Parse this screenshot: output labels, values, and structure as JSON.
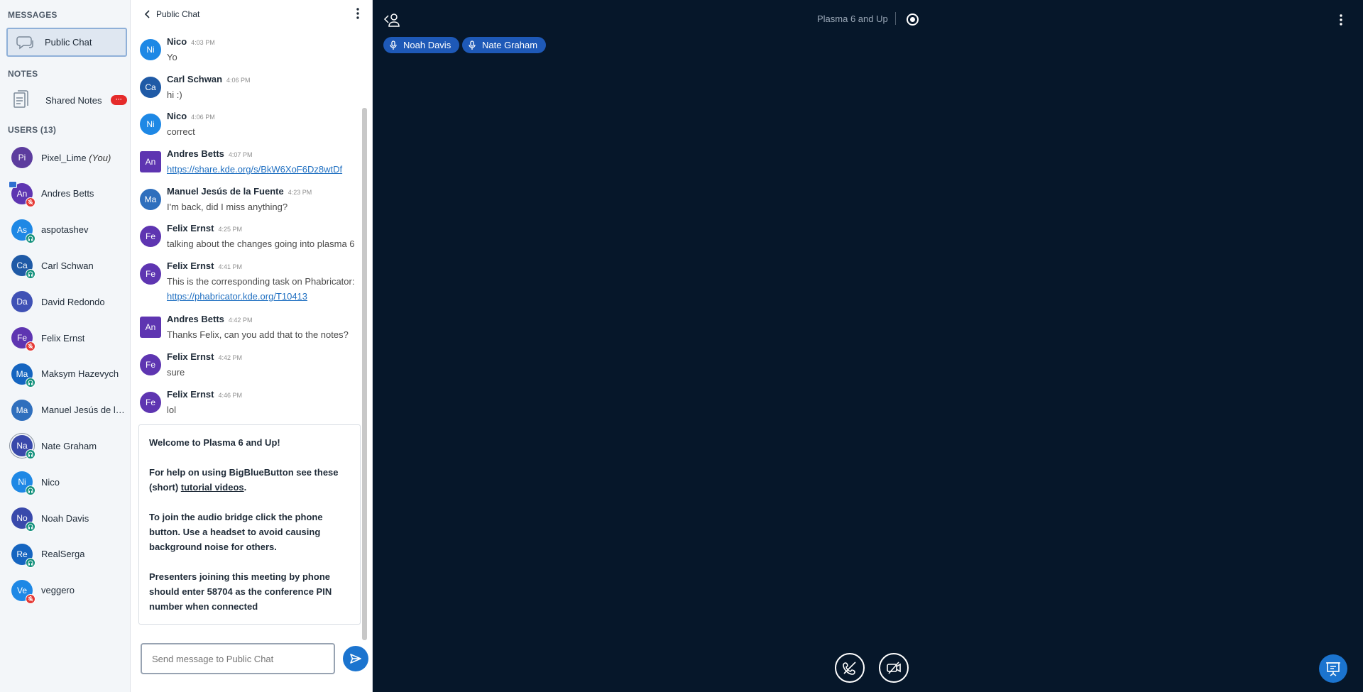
{
  "sidebar": {
    "messages_title": "MESSAGES",
    "public_chat_label": "Public Chat",
    "notes_title": "NOTES",
    "shared_notes_label": "Shared Notes",
    "shared_notes_badge": "···",
    "users_title": "USERS (13)",
    "users": [
      {
        "initials": "Pi",
        "name": "Pixel_Lime",
        "suffix": "(You)",
        "color": "#5c3c9e",
        "mic": ""
      },
      {
        "initials": "An",
        "name": "Andres Betts",
        "suffix": "",
        "color": "#5e35b1",
        "mic": "muted",
        "presenter": true
      },
      {
        "initials": "As",
        "name": "aspotashev",
        "suffix": "",
        "color": "#1e88e5",
        "mic": "listen"
      },
      {
        "initials": "Ca",
        "name": "Carl Schwan",
        "suffix": "",
        "color": "#1f5aa6",
        "mic": "listen"
      },
      {
        "initials": "Da",
        "name": "David Redondo",
        "suffix": "",
        "color": "#3f51b5",
        "mic": ""
      },
      {
        "initials": "Fe",
        "name": "Felix Ernst",
        "suffix": "",
        "color": "#5e35b1",
        "mic": "muted"
      },
      {
        "initials": "Ma",
        "name": "Maksym Hazevych",
        "suffix": "",
        "color": "#1565c0",
        "mic": "listen"
      },
      {
        "initials": "Ma",
        "name": "Manuel Jesús de la F...",
        "suffix": "",
        "color": "#2f6fbd",
        "mic": ""
      },
      {
        "initials": "Na",
        "name": "Nate Graham",
        "suffix": "",
        "color": "#3949ab",
        "mic": "listen",
        "ring": true
      },
      {
        "initials": "Ni",
        "name": "Nico",
        "suffix": "",
        "color": "#1e88e5",
        "mic": "listen"
      },
      {
        "initials": "No",
        "name": "Noah Davis",
        "suffix": "",
        "color": "#3949ab",
        "mic": "listen"
      },
      {
        "initials": "Re",
        "name": "RealSerga",
        "suffix": "",
        "color": "#1565c0",
        "mic": "listen"
      },
      {
        "initials": "Ve",
        "name": "veggero",
        "suffix": "",
        "color": "#1e88e5",
        "mic": "muted"
      }
    ]
  },
  "chat": {
    "title": "Public Chat",
    "messages": [
      {
        "initials": "Ni",
        "sender": "Nico",
        "time": "4:03 PM",
        "lines": [
          "Yo"
        ],
        "color": "#1e88e5"
      },
      {
        "initials": "Ca",
        "sender": "Carl Schwan",
        "time": "4:06 PM",
        "lines": [
          "hi :)"
        ],
        "color": "#1f5aa6"
      },
      {
        "initials": "Ni",
        "sender": "Nico",
        "time": "4:06 PM",
        "lines": [
          "correct"
        ],
        "color": "#1e88e5"
      },
      {
        "initials": "An",
        "sender": "Andres Betts",
        "time": "4:07 PM",
        "link": "https://share.kde.org/s/BkW6XoF6Dz8wtDf",
        "lines": [],
        "color": "#5e35b1",
        "square": true
      },
      {
        "initials": "Ma",
        "sender": "Manuel Jesús de la Fuente",
        "time": "4:23 PM",
        "lines": [
          "I'm back, did I miss anything?"
        ],
        "color": "#2f6fbd"
      },
      {
        "initials": "Fe",
        "sender": "Felix Ernst",
        "time": "4:25 PM",
        "lines": [
          "talking about the changes going into plasma 6"
        ],
        "color": "#5e35b1"
      },
      {
        "initials": "Fe",
        "sender": "Felix Ernst",
        "time": "4:41 PM",
        "lines": [
          "This is the corresponding task on Phabricator:"
        ],
        "link": "https://phabricator.kde.org/T10413",
        "color": "#5e35b1"
      },
      {
        "initials": "An",
        "sender": "Andres Betts",
        "time": "4:42 PM",
        "lines": [
          "Thanks Felix, can you add that to the notes?"
        ],
        "color": "#5e35b1",
        "square": true
      },
      {
        "initials": "Fe",
        "sender": "Felix Ernst",
        "time": "4:42 PM",
        "lines": [
          "sure"
        ],
        "color": "#5e35b1"
      },
      {
        "initials": "Fe",
        "sender": "Felix Ernst",
        "time": "4:46 PM",
        "lines": [
          "lol"
        ],
        "color": "#5e35b1"
      }
    ],
    "welcome": {
      "p1_pre": "Welcome to ",
      "p1_bold": "Plasma 6 and Up",
      "p1_post": "!",
      "p2_pre": "For help on using BigBlueButton see these (short) ",
      "p2_link": "tutorial videos",
      "p2_post": ".",
      "p3": "To join the audio bridge click the phone button. Use a headset to avoid causing background noise for others.",
      "p4": "Presenters joining this meeting by phone should enter 58704 as the conference PIN number when connected"
    },
    "input_placeholder": "Send message to Public Chat"
  },
  "main": {
    "meeting_title": "Plasma 6 and Up",
    "talkers": [
      "Noah Davis",
      "Nate Graham"
    ]
  }
}
